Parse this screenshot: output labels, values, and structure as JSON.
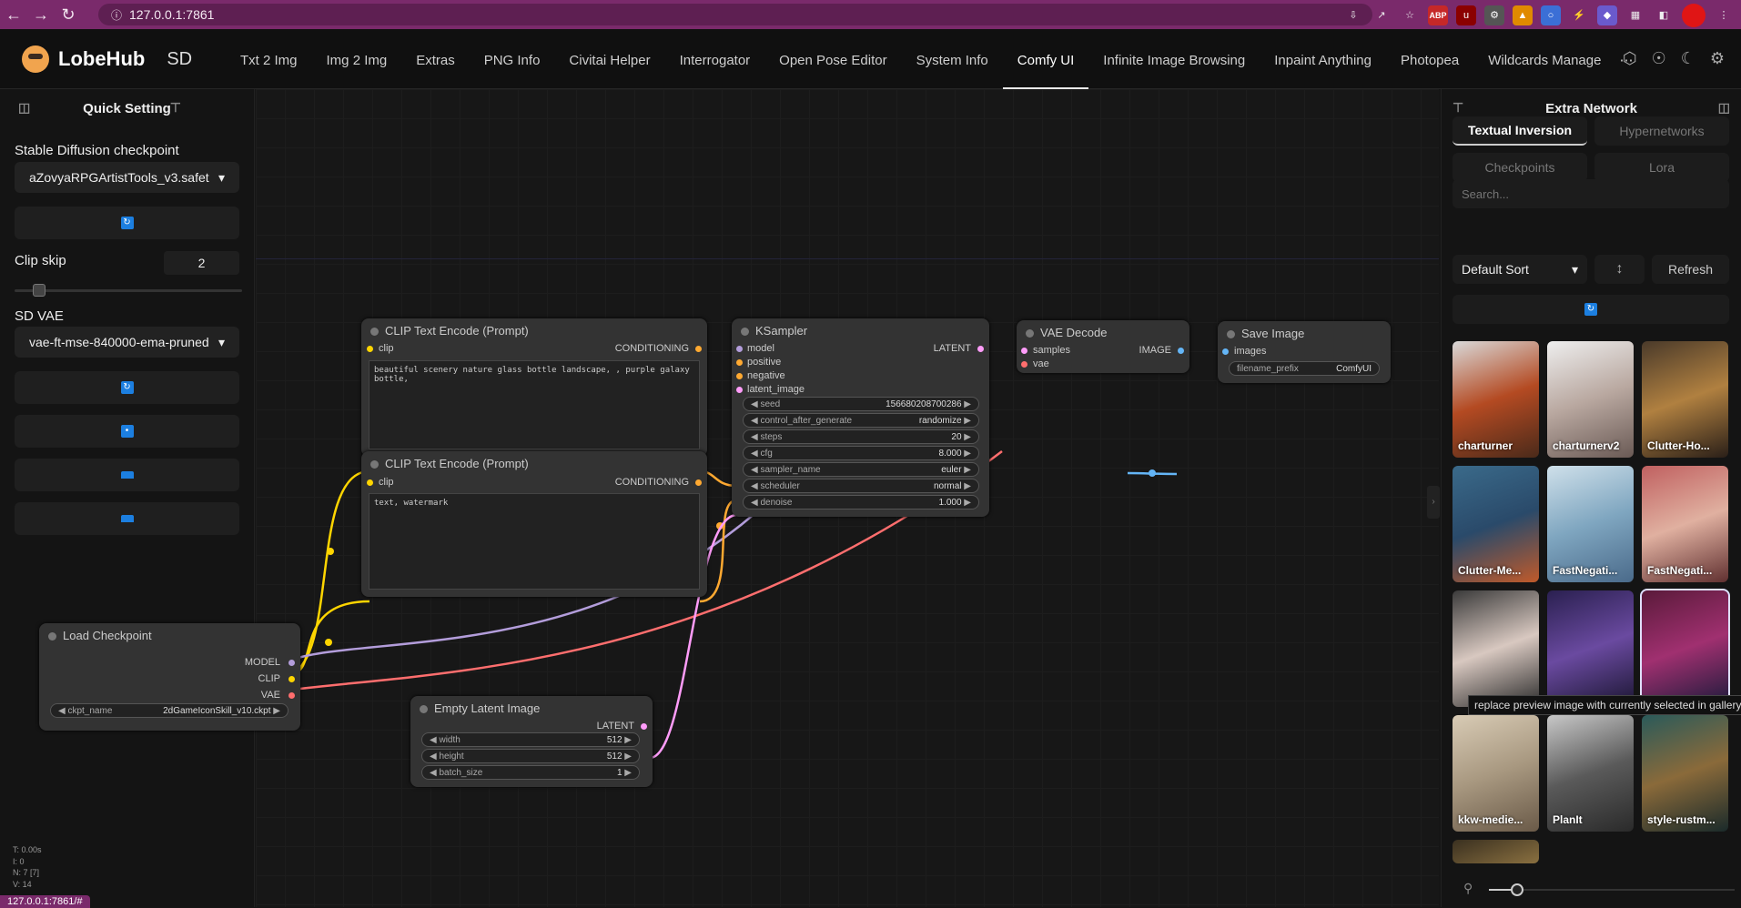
{
  "browser": {
    "url": "127.0.0.1:7861",
    "status_url": "127.0.0.1:7861/#"
  },
  "app": {
    "brand": "LobeHub",
    "suffix": "SD"
  },
  "tabs": [
    "Txt 2 Img",
    "Img 2 Img",
    "Extras",
    "PNG Info",
    "Civitai Helper",
    "Interrogator",
    "Open Pose Editor",
    "System Info",
    "Comfy UI",
    "Infinite Image Browsing",
    "Inpaint Anything",
    "Photopea",
    "Wildcards Manage"
  ],
  "active_tab": "Comfy UI",
  "quick": {
    "title": "Quick Setting",
    "checkpoint_label": "Stable Diffusion checkpoint",
    "checkpoint_value": "aZovyaRPGArtistTools_v3.safet",
    "clip_label": "Clip skip",
    "clip_value": "2",
    "clip_level": 0.083,
    "vae_label": "SD VAE",
    "vae_value": "vae-ft-mse-840000-ema-pruned"
  },
  "nodes": {
    "clip1": {
      "title": "CLIP Text Encode (Prompt)",
      "in": "clip",
      "out": "CONDITIONING",
      "text": "beautiful scenery nature glass bottle landscape, , purple galaxy bottle,"
    },
    "clip2": {
      "title": "CLIP Text Encode (Prompt)",
      "in": "clip",
      "out": "CONDITIONING",
      "text": "text, watermark"
    },
    "ksampler": {
      "title": "KSampler",
      "inputs": [
        "model",
        "positive",
        "negative",
        "latent_image"
      ],
      "out": "LATENT",
      "widgets": [
        {
          "n": "seed",
          "v": "156680208700286"
        },
        {
          "n": "control_after_generate",
          "v": "randomize"
        },
        {
          "n": "steps",
          "v": "20"
        },
        {
          "n": "cfg",
          "v": "8.000"
        },
        {
          "n": "sampler_name",
          "v": "euler"
        },
        {
          "n": "scheduler",
          "v": "normal"
        },
        {
          "n": "denoise",
          "v": "1.000"
        }
      ]
    },
    "vae": {
      "title": "VAE Decode",
      "inputs": [
        "samples",
        "vae"
      ],
      "out": "IMAGE"
    },
    "save": {
      "title": "Save Image",
      "in": "images",
      "wname": "filename_prefix",
      "wval": "ComfyUI"
    },
    "load": {
      "title": "Load Checkpoint",
      "outs": [
        "MODEL",
        "CLIP",
        "VAE"
      ],
      "wname": "ckpt_name",
      "wval": "2dGameIconSkill_v10.ckpt"
    },
    "latent": {
      "title": "Empty Latent Image",
      "out": "LATENT",
      "widgets": [
        {
          "n": "width",
          "v": "512"
        },
        {
          "n": "height",
          "v": "512"
        },
        {
          "n": "batch_size",
          "v": "1"
        }
      ]
    }
  },
  "stats": [
    "T: 0.00s",
    "I: 0",
    "N: 7 [7]",
    "V: 14"
  ],
  "extra": {
    "title": "Extra Network",
    "tabs": [
      "Textual Inversion",
      "Hypernetworks",
      "Checkpoints",
      "Lora"
    ],
    "search_placeholder": "Search...",
    "sort": "Default Sort",
    "refresh": "Refresh",
    "thumbs": [
      "charturner",
      "charturnerv2",
      "Clutter-Ho...",
      "Clutter-Me...",
      "FastNegati...",
      "FastNegati...",
      "",
      "",
      "",
      "kkw-medie...",
      "PlanIt",
      "style-rustm..."
    ],
    "tooltip": "replace preview image with currently selected in gallery"
  },
  "colors": {
    "clip": "#ffd500",
    "model": "#b39ddb",
    "vae": "#ff6e6e",
    "cond": "#ffa931",
    "latent": "#ff9cf9",
    "image": "#64b5f6"
  }
}
